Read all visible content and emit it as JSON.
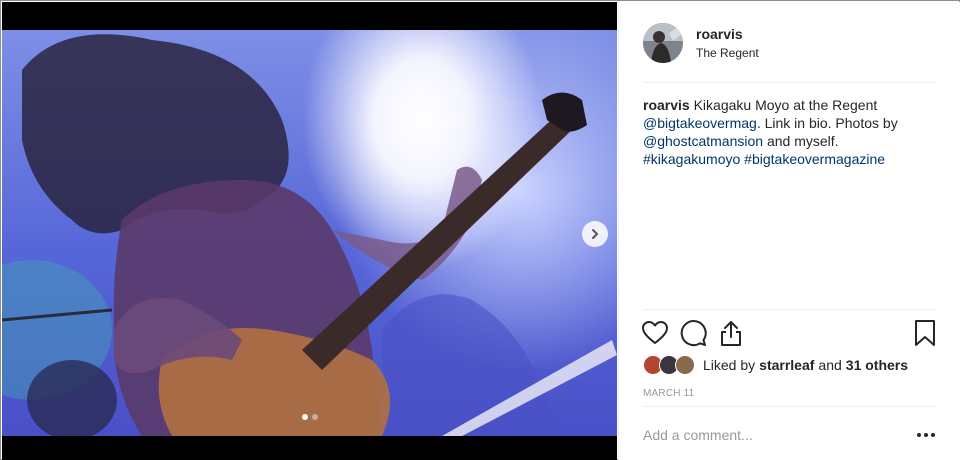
{
  "post": {
    "username": "roarvis",
    "location": "The Regent",
    "caption": {
      "username": "roarvis",
      "text1": " Kikagaku Moyo at the Regent ",
      "mention1": "@bigtakeovermag",
      "text2": ". Link in bio. Photos by ",
      "mention2": "@ghostcatmansion",
      "text3": " and myself. ",
      "hashtag1": "#kikagakumoyo",
      "text4": " ",
      "hashtag2": "#bigtakeovermagazine"
    },
    "likes": {
      "prefix": "Liked by",
      "user": "starrleaf",
      "conj": "and",
      "others": "31 others"
    },
    "date": "MARCH 11",
    "comment_placeholder": "Add a comment...",
    "carousel": {
      "current": 1,
      "total": 2
    }
  },
  "icons": {
    "like": "heart-icon",
    "comment": "comment-icon",
    "share": "share-icon",
    "save": "bookmark-icon",
    "next": "chevron-right-icon",
    "more": "more-options-icon"
  },
  "colors": {
    "link": "#003569",
    "muted": "#999999",
    "text": "#262626",
    "divider": "#efefef"
  }
}
